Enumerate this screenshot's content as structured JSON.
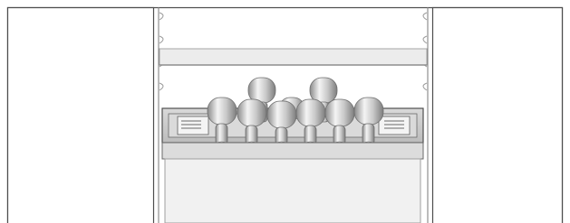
{
  "illustration": {
    "subject": "fridge-interior-with-bottle-rack",
    "bottle_count": 9,
    "front_row_bottles": 6,
    "back_row_bottles": 3,
    "colors": {
      "outline": "#555555",
      "panel": "#ffffff",
      "shelf": "#e9e9e9",
      "rack_tray": "#c9c9c9",
      "bottle_base": "#a6a6a6",
      "bottle_highlight": "#f2f2f2",
      "drawer": "#f1f1f1"
    }
  }
}
